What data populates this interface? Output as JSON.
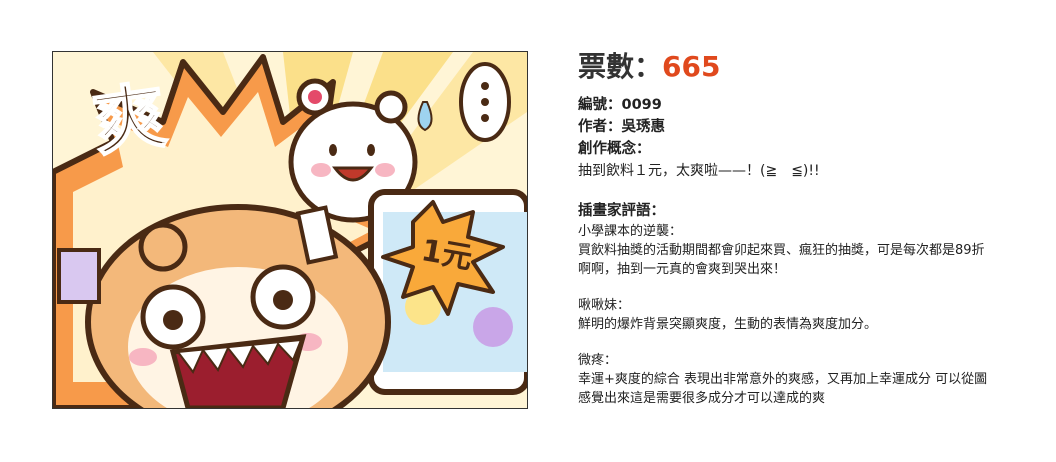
{
  "entry": {
    "votes_label": "票數：",
    "votes_count": "665",
    "number_line": "編號：0099",
    "author_line": "作者：吳琇惠",
    "concept_label": "創作概念：",
    "concept_text": "抽到飲料１元，太爽啦——！(≧　≦)!!"
  },
  "artwork": {
    "big_char": "爽",
    "price_tag": "1元"
  },
  "reviews": {
    "title": "插畫家評語：",
    "items": [
      {
        "reviewer": "小學課本的逆襲：",
        "text_line1": "買飲料抽獎的活動期間都會卯起來買、瘋狂的抽獎，可是每次都是89折",
        "text_line2": "啊啊，抽到一元真的會爽到哭出來！"
      },
      {
        "reviewer": "啾啾妹：",
        "text_line1": "鮮明的爆炸背景突顯爽度，生動的表情為爽度加分。",
        "text_line2": ""
      },
      {
        "reviewer": "微疼：",
        "text_line1": "幸運+爽度的綜合 表現出非常意外的爽感，又再加上幸運成分 可以從圖",
        "text_line2": "感覺出來這是需要很多成分才可以達成的爽"
      }
    ]
  },
  "colors": {
    "accent": "#e0491d",
    "outline": "#4a2a14",
    "hamster": "#f3b87a",
    "burst": "#f79a4a",
    "background_yellow": "#fbe9a0"
  }
}
